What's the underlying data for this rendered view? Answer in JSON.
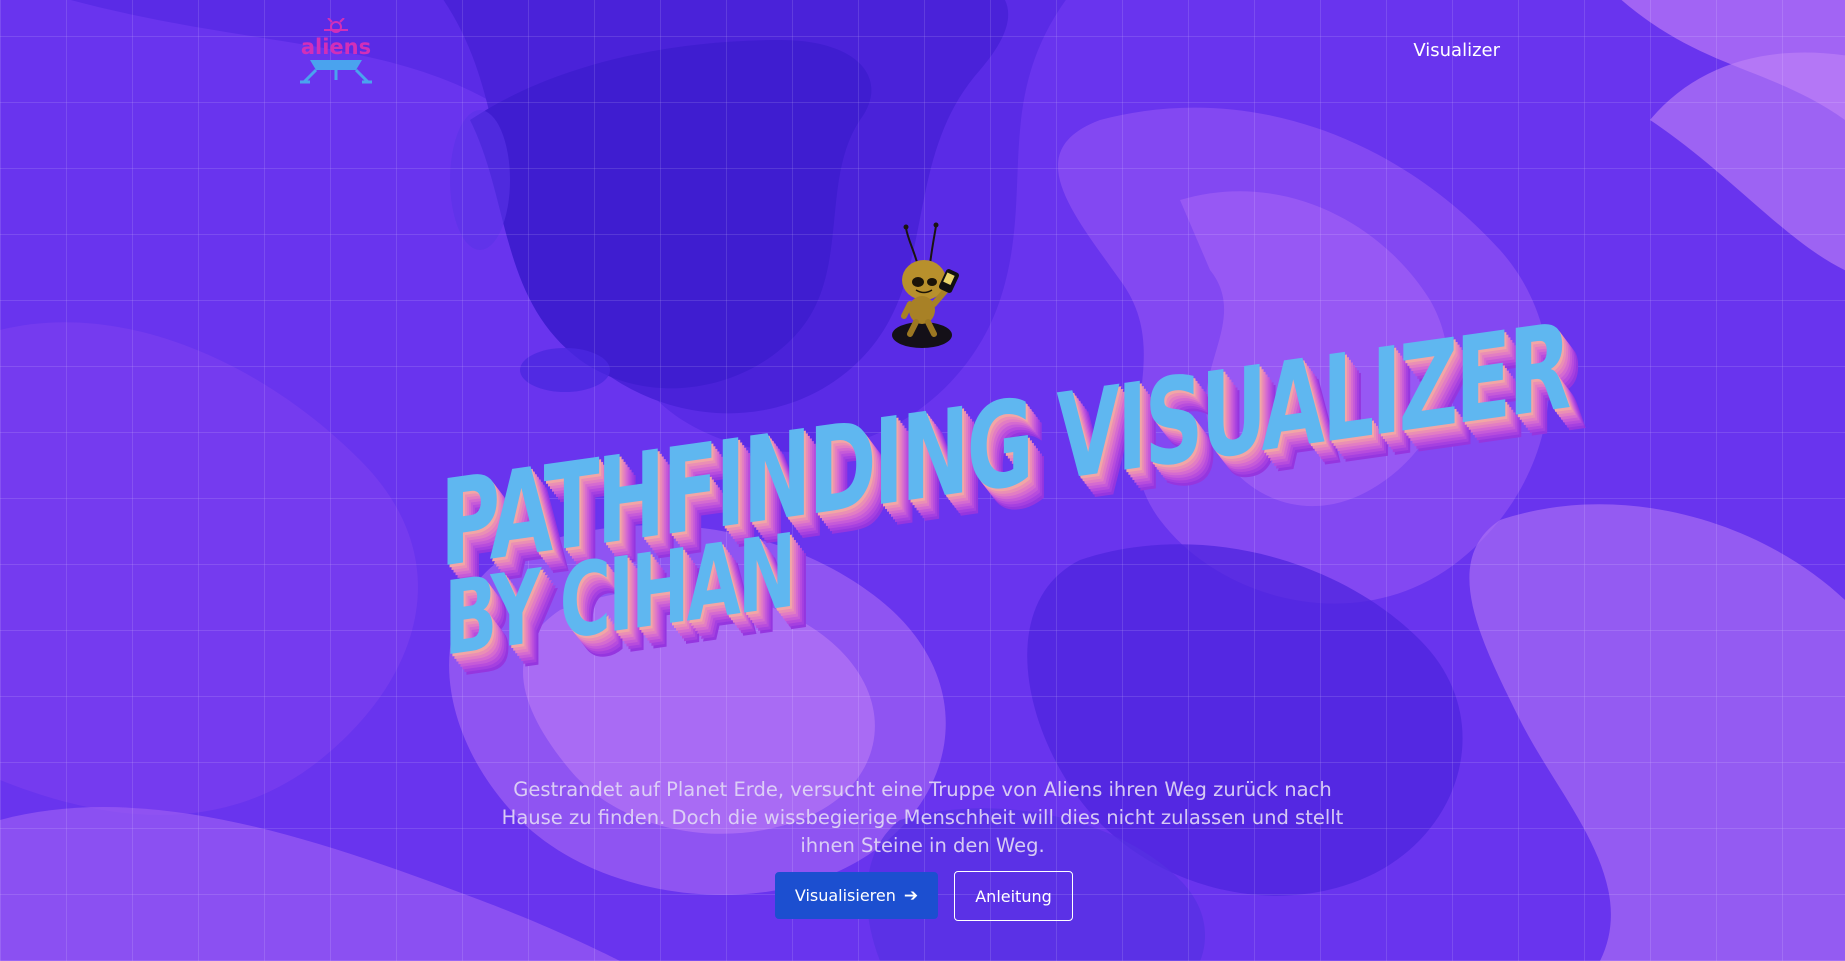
{
  "nav": {
    "logo_text": "aliens",
    "link_label": "Visualizer"
  },
  "hero": {
    "title": "Pathfinding Visualizer",
    "subtitle": "by Cihan",
    "description": "Gestrandet auf Planet Erde, versucht eine Truppe von Aliens ihren Weg zurück nach Hause zu finden. Doch die wissbegierige Menschheit will dies nicht zulassen und stellt ihnen Steine in den Weg.",
    "primary_button": "Visualisieren",
    "primary_button_icon": "arrow-right-icon",
    "secondary_button": "Anleitung"
  },
  "colors": {
    "background": "#5a2ae8",
    "title_face": "#5fb7f0",
    "title_extrude": "#c65bd8",
    "logo": "#d22fb8",
    "primary_button": "#1c4fd0"
  }
}
